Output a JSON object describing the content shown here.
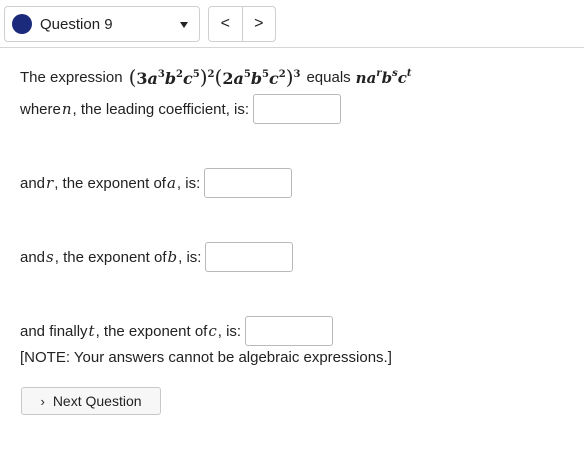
{
  "header": {
    "question_label": "Question 9",
    "prev_symbol": "<",
    "next_symbol": ">",
    "accent_color": "#1b2a7a"
  },
  "question": {
    "intro": "The expression",
    "equals_text": "equals",
    "line2_text": "where n, the leading coefficient, is:",
    "line2_prefix": "where ",
    "line2_var": "n",
    "line2_suffix": ", the leading coefficient, is:",
    "line3_prefix": "and ",
    "line3_var": "r",
    "line3_mid": ", the exponent of ",
    "line3_base": "a",
    "line3_suffix": ", is:",
    "line4_prefix": "and ",
    "line4_var": "s",
    "line4_mid": ", the exponent of ",
    "line4_base": "b",
    "line4_suffix": ", is:",
    "line5_prefix": "and finally ",
    "line5_var": "t",
    "line5_mid": ", the exponent of ",
    "line5_base": "c",
    "line5_suffix": ", is:",
    "note": "[NOTE: Your answers cannot be algebraic expressions.]"
  },
  "answers": {
    "n": "",
    "r": "",
    "s": "",
    "t": ""
  },
  "footer": {
    "next_label": "Next Question"
  }
}
